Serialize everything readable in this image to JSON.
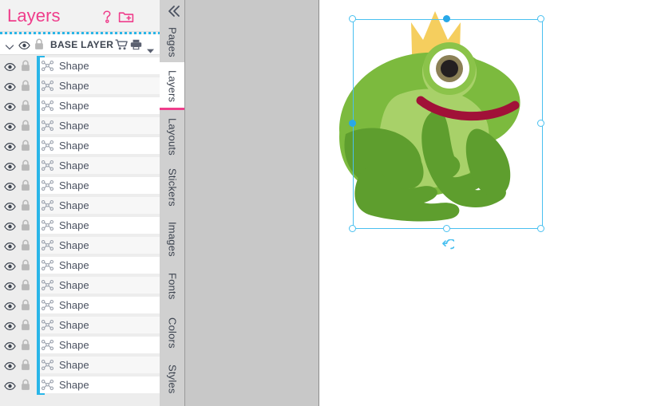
{
  "panel": {
    "title": "Layers",
    "help_icon": "question-mark-icon",
    "add_folder_icon": "add-folder-icon",
    "accent_color": "#ef3d8b",
    "selection_color": "#29b6e8"
  },
  "base_layer": {
    "label": "BASE LAYER",
    "chevron_icon": "chevron-down-icon",
    "eye_icon": "eye-icon",
    "lock_icon": "lock-icon",
    "cart_icon": "cart-icon",
    "print_icon": "printer-icon",
    "caret_icon": "caret-down-icon"
  },
  "layer_rows": [
    {
      "label": "Shape"
    },
    {
      "label": "Shape"
    },
    {
      "label": "Shape"
    },
    {
      "label": "Shape"
    },
    {
      "label": "Shape"
    },
    {
      "label": "Shape"
    },
    {
      "label": "Shape"
    },
    {
      "label": "Shape"
    },
    {
      "label": "Shape"
    },
    {
      "label": "Shape"
    },
    {
      "label": "Shape"
    },
    {
      "label": "Shape"
    },
    {
      "label": "Shape"
    },
    {
      "label": "Shape"
    },
    {
      "label": "Shape"
    },
    {
      "label": "Shape"
    },
    {
      "label": "Shape"
    }
  ],
  "tabs": {
    "collapse_icon": "double-chevron-left-icon",
    "items": [
      {
        "label": "Pages",
        "active": false
      },
      {
        "label": "Layers",
        "active": true
      },
      {
        "label": "Layouts",
        "active": false
      },
      {
        "label": "Stickers",
        "active": false
      },
      {
        "label": "Images",
        "active": false
      },
      {
        "label": "Fonts",
        "active": false
      },
      {
        "label": "Colors",
        "active": false
      },
      {
        "label": "Styles",
        "active": false
      }
    ]
  },
  "canvas": {
    "artwork_name": "frog-prince-illustration",
    "rotate_icon": "rotate-ccw-icon",
    "colors": {
      "crown": "#f5ce5e",
      "body": "#7cba3e",
      "belly": "#a8d169",
      "legs": "#5e9e2e",
      "mouth": "#a11138",
      "eye_pupil": "#231f20",
      "eye_iris": "#8b8056",
      "selection": "#49c0f0"
    }
  }
}
